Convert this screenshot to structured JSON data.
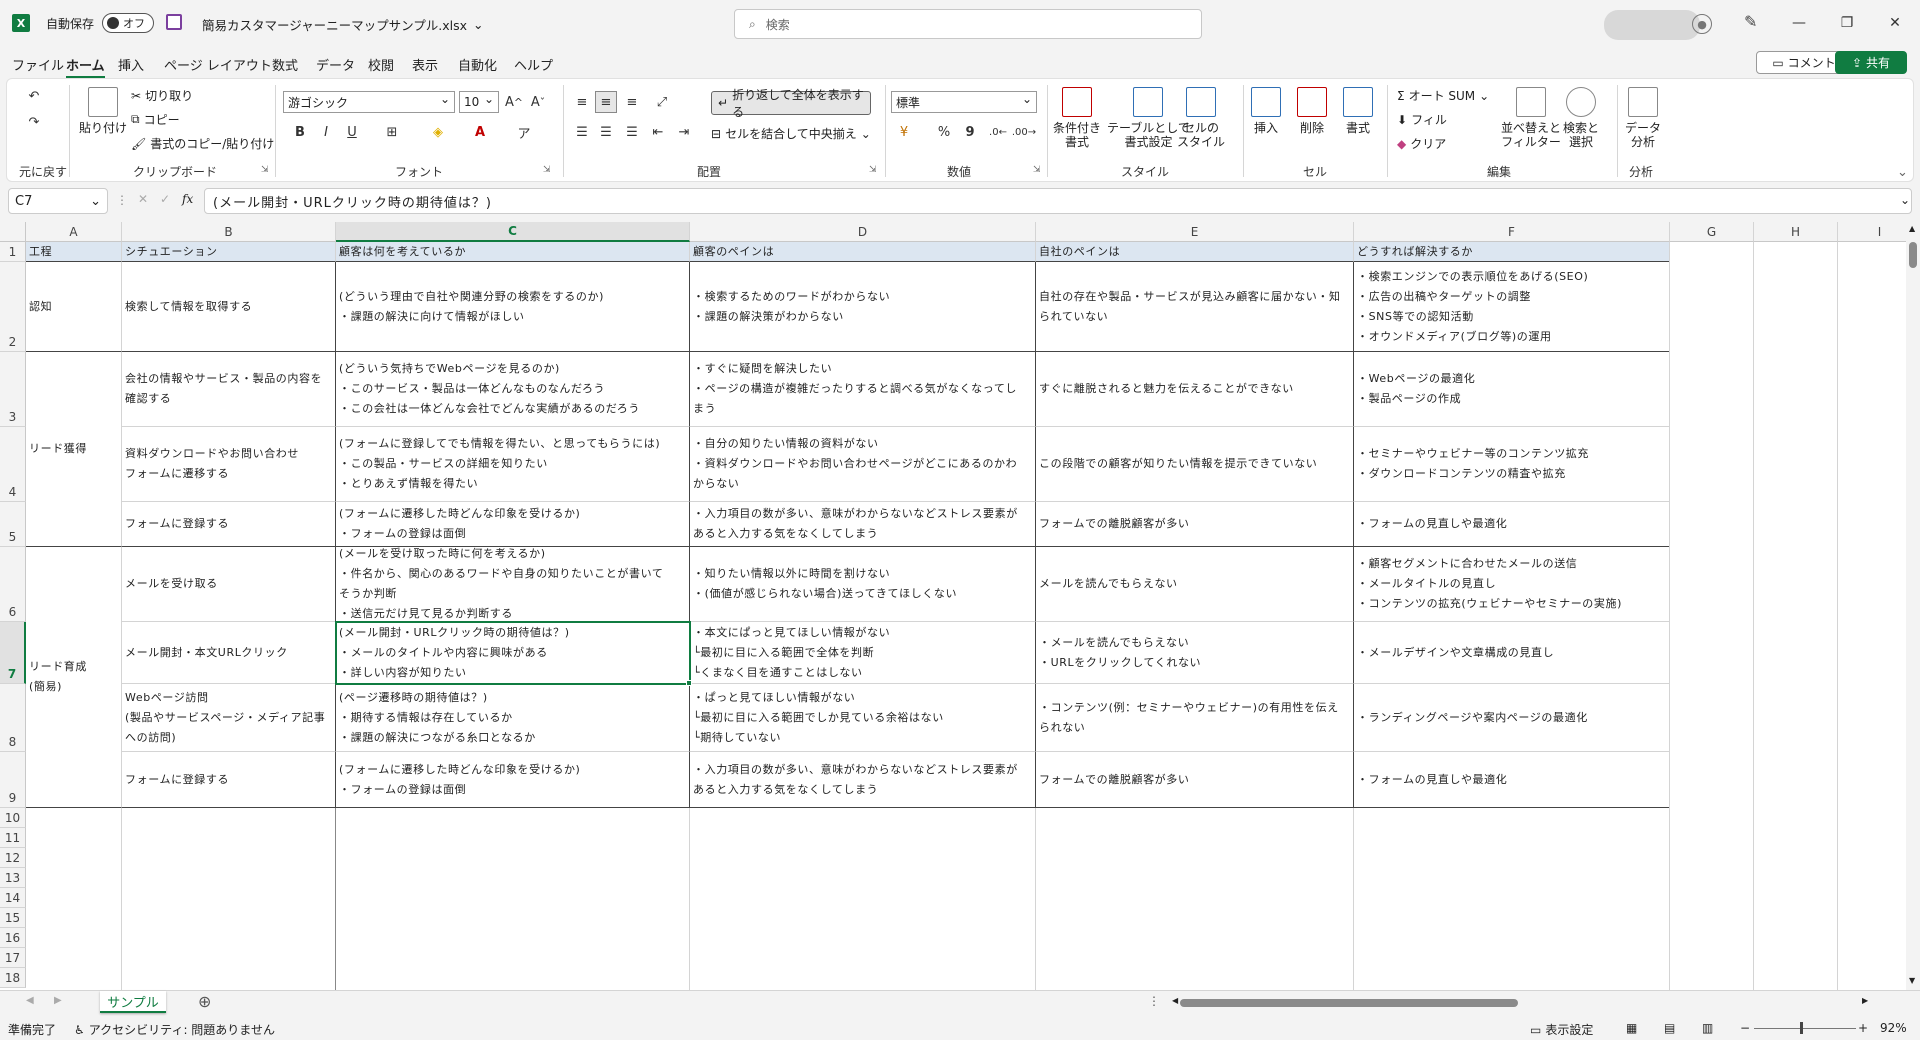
{
  "titlebar": {
    "app_icon": "excel-icon",
    "autosave_label": "自動保存",
    "autosave_state": "オフ",
    "filename": "簡易カスタマージャーニーマップサンプル.xlsx",
    "search_placeholder": "検索",
    "minimize": "—",
    "restore": "❐",
    "close": "✕"
  },
  "menu": {
    "items": [
      "ファイル",
      "ホーム",
      "挿入",
      "ページ レイアウト",
      "数式",
      "データ",
      "校閲",
      "表示",
      "自動化",
      "ヘルプ"
    ],
    "active": "ホーム",
    "comment_label": "コメント",
    "share_label": "共有"
  },
  "ribbon": {
    "groups": {
      "undo": "元に戻す",
      "clipboard": "クリップボード",
      "font": "フォント",
      "alignment": "配置",
      "number": "数値",
      "styles": "スタイル",
      "cells": "セル",
      "editing": "編集",
      "analysis": "分析"
    },
    "clipboard": {
      "paste": "貼り付け",
      "cut": "切り取り",
      "copy": "コピー",
      "format_painter": "書式のコピー/貼り付け"
    },
    "font": {
      "name": "游ゴシック",
      "size": "10",
      "bold": "B",
      "italic": "I",
      "underline": "U"
    },
    "alignment": {
      "wrap_text": "折り返して全体を表示する",
      "merge_center": "セルを結合して中央揃え"
    },
    "number": {
      "format": "標準",
      "percent": "%",
      "comma": "9"
    },
    "styles": {
      "conditional": "条件付き\n書式",
      "as_table": "テーブルとして\n書式設定",
      "cell_styles": "セルの\nスタイル"
    },
    "cells": {
      "insert": "挿入",
      "delete": "削除",
      "format": "書式"
    },
    "editing": {
      "autosum": "オート SUM",
      "fill": "フィル",
      "clear": "クリア",
      "sort_filter": "並べ替えと\nフィルター",
      "find_select": "検索と\n選択"
    },
    "analysis": {
      "data_analysis": "データ\n分析"
    }
  },
  "formula_bar": {
    "name_box": "C7",
    "fx": "fx",
    "formula": "(メール開封・URLクリック時の期待値は？)"
  },
  "grid": {
    "columns": [
      "A",
      "B",
      "C",
      "D",
      "E",
      "F",
      "G",
      "H",
      "I"
    ],
    "selected_column": "C",
    "selected_row": "7",
    "rows": [
      "1",
      "2",
      "3",
      "4",
      "5",
      "6",
      "7",
      "8",
      "9",
      "10",
      "11",
      "12",
      "13",
      "14",
      "15",
      "16",
      "17",
      "18"
    ],
    "headers": {
      "A": "工程",
      "B": "シチュエーション",
      "C": "顧客は何を考えているか",
      "D": "顧客のペインは",
      "E": "自社のペインは",
      "F": "どうすれば解決するか"
    },
    "stages": {
      "awareness": "認知",
      "lead_acquisition": "リード獲得",
      "lead_nurturing": "リード育成\n(簡易)"
    },
    "row2": {
      "B": "検索して情報を取得する",
      "C": "(どういう理由で自社や関連分野の検索をするのか)\n・課題の解決に向けて情報がほしい",
      "D": "・検索するためのワードがわからない\n・課題の解決策がわからない",
      "E": "自社の存在や製品・サービスが見込み顧客に届かない・知\nられていない",
      "F": "・検索エンジンでの表示順位をあげる(SEO)\n・広告の出稿やターゲットの調整\n・SNS等での認知活動\n・オウンドメディア(ブログ等)の運用"
    },
    "row3": {
      "B": "会社の情報やサービス・製品の内容を\n確認する",
      "C": "(どういう気持ちでWebページを見るのか)\n・このサービス・製品は一体どんなものなんだろう\n・この会社は一体どんな会社でどんな実績があるのだろう",
      "D": "・すぐに疑問を解決したい\n・ページの構造が複雑だったりすると調べる気がなくなってし\nまう",
      "E": "すぐに離脱されると魅力を伝えることができない",
      "F": "・Webページの最適化\n・製品ページの作成"
    },
    "row4": {
      "B": "資料ダウンロードやお問い合わせ\nフォームに遷移する",
      "C": "(フォームに登録してでも情報を得たい、と思ってもらうには)\n・この製品・サービスの詳細を知りたい\n・とりあえず情報を得たい",
      "D": "・自分の知りたい情報の資料がない\n・資料ダウンロードやお問い合わせページがどこにあるのかわ\nからない",
      "E": "この段階での顧客が知りたい情報を提示できていない",
      "F": "・セミナーやウェビナー等のコンテンツ拡充\n・ダウンロードコンテンツの精査や拡充"
    },
    "row5": {
      "B": "フォームに登録する",
      "C": "(フォームに遷移した時どんな印象を受けるか)\n・フォームの登録は面倒",
      "D": "・入力項目の数が多い、意味がわからないなどストレス要素が\nあると入力する気をなくしてしまう",
      "E": "フォームでの離脱顧客が多い",
      "F": "・フォームの見直しや最適化"
    },
    "row6": {
      "B": "メールを受け取る",
      "C": "(メールを受け取った時に何を考えるか)\n・件名から、関心のあるワードや自身の知りたいことが書いて\nそうか判断\n・送信元だけ見て見るか判断する",
      "D": "・知りたい情報以外に時間を割けない\n・(価値が感じられない場合)送ってきてほしくない",
      "E": "メールを読んでもらえない",
      "F": "・顧客セグメントに合わせたメールの送信\n・メールタイトルの見直し\n・コンテンツの拡充(ウェビナーやセミナーの実施)"
    },
    "row7": {
      "B": "メール開封・本文URLクリック",
      "C": "(メール開封・URLクリック時の期待値は？)\n・メールのタイトルや内容に興味がある\n・詳しい内容が知りたい",
      "D": "・本文にぱっと見てほしい情報がない\n└最初に目に入る範囲で全体を判断\n└くまなく目を通すことはしない",
      "E": "・メールを読んでもらえない\n・URLをクリックしてくれない",
      "F": "・メールデザインや文章構成の見直し"
    },
    "row8": {
      "B": "Webページ訪問\n(製品やサービスページ・メディア記事\nへの訪問)",
      "C": "(ページ遷移時の期待値は？)\n・期待する情報は存在しているか\n・課題の解決につながる糸口となるか",
      "D": "・ぱっと見てほしい情報がない\n└最初に目に入る範囲でしか見ている余裕はない\n└期待していない",
      "E": "・コンテンツ(例：セミナーやウェビナー)の有用性を伝え\nられない",
      "F": "・ランディングページや案内ページの最適化"
    },
    "row9": {
      "B": "フォームに登録する",
      "C": "(フォームに遷移した時どんな印象を受けるか)\n・フォームの登録は面倒",
      "D": "・入力項目の数が多い、意味がわからないなどストレス要素が\nあると入力する気をなくしてしまう",
      "E": "フォームでの離脱顧客が多い",
      "F": "・フォームの見直しや最適化"
    }
  },
  "sheets": {
    "active": "サンプル",
    "add": "⊕"
  },
  "status": {
    "ready": "準備完了",
    "accessibility": "アクセシビリティ: 問題ありません",
    "display_settings": "表示設定",
    "zoom": "92%"
  },
  "colors": {
    "accent": "#107c41",
    "header_fill": "#dce6f1"
  }
}
